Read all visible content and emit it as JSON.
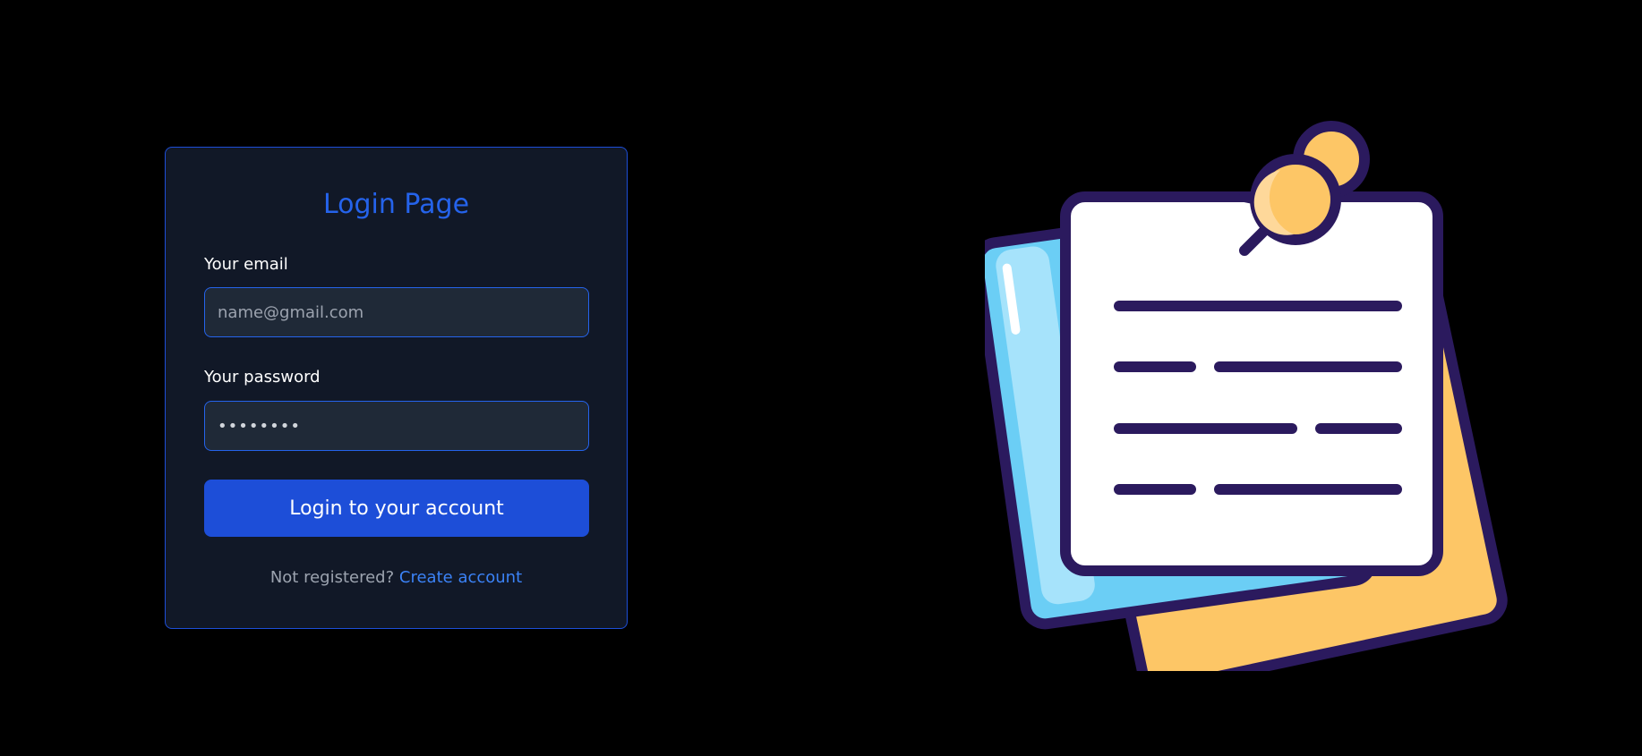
{
  "login": {
    "title": "Login Page",
    "email_label": "Your email",
    "email_placeholder": "name@gmail.com",
    "password_label": "Your password",
    "password_value": "••••••••",
    "submit_label": "Login to your account",
    "register_prompt": "Not registered?",
    "register_link": "Create account"
  },
  "illustration": {
    "icon": "sticky-notes-icon"
  },
  "colors": {
    "background": "#000000",
    "card": "#111827",
    "accent": "#1d4ed8",
    "title": "#2563eb",
    "link": "#3b82f6",
    "note_yellow": "#fdc666",
    "note_blue": "#6bcef5",
    "note_outline": "#2b1a5e"
  }
}
